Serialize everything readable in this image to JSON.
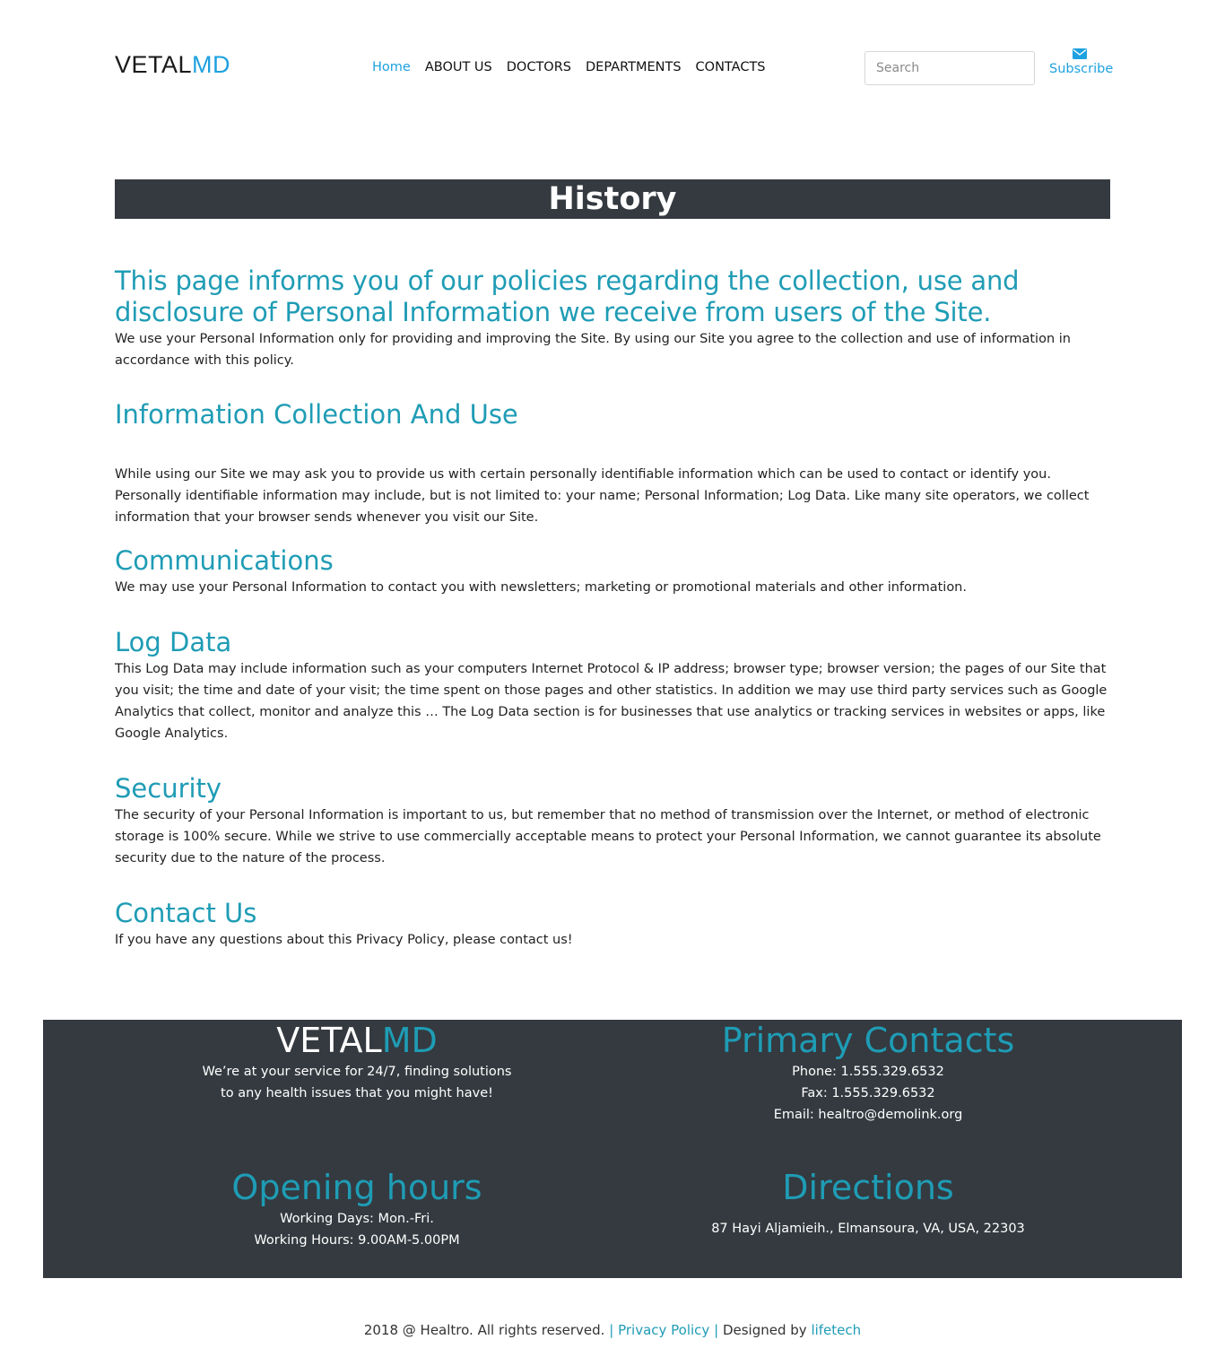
{
  "header": {
    "logo_part1": "VETAL",
    "logo_part2": "MD",
    "nav": [
      "Home",
      "ABOUT US",
      "DOCTORS",
      "DEPARTMENTS",
      "CONTACTS"
    ],
    "search_placeholder": "Search",
    "subscribe_label": "Subscribe",
    "subscribe_icon": "envelope-icon"
  },
  "banner": {
    "title": "History"
  },
  "content": {
    "lead_heading": "This page informs you of our policies regarding the collection, use and disclosure of Personal Information we receive from users of the Site.",
    "lead_text": "We use your Personal Information only for providing and improving the Site. By using our Site you agree to the collection and use of information in accordance with this policy.",
    "sections": [
      {
        "heading": "Information Collection And Use",
        "text": "While using our Site we may ask you to provide us with certain personally identifiable information which can be used to contact or identify you. Personally identifiable information may include, but is not limited to: your name; Personal Information; Log Data. Like many site operators, we collect information that your browser sends whenever you visit our Site."
      },
      {
        "heading": "Communications",
        "text": "We may use your Personal Information to contact you with newsletters; marketing or promotional materials and other information."
      },
      {
        "heading": "Log Data",
        "text": "This Log Data may include information such as your computers Internet Protocol & IP address; browser type; browser version; the pages of our Site that you visit; the time and date of your visit; the time spent on those pages and other statistics. In addition we may use third party services such as Google Analytics that collect, monitor and analyze this … The Log Data section is for businesses that use analytics or tracking services in websites or apps, like Google Analytics."
      },
      {
        "heading": "Security",
        "text": "The security of your Personal Information is important to us, but remember that no method of transmission over the Internet, or method of electronic storage is 100% secure. While we strive to use commercially acceptable means to protect your Personal Information, we cannot guarantee its absolute security due to the nature of the process."
      },
      {
        "heading": "Contact Us",
        "text": "If you have any questions about this Privacy Policy, please contact us!"
      }
    ]
  },
  "footer": {
    "logo_part1": "VETAL",
    "logo_part2": "MD",
    "tagline_1": "We’re at your service for 24/7, finding solutions",
    "tagline_2": "to any health issues that you might have!",
    "contacts_title": "Primary Contacts",
    "phone": "Phone: 1.555.329.6532",
    "fax": "Fax: 1.555.329.6532",
    "email": "Email: healtro@demolink.org",
    "hours_title": "Opening hours",
    "working_days": "Working Days: Mon.-Fri.",
    "working_hours": "Working Hours: 9.00AM-5.00PM",
    "directions_title": "Directions",
    "address": "87 Hayi Aljamieih., Elmansoura, VA, USA, 22303"
  },
  "copyright": {
    "text": "2018 @ Healtro. All rights reserved.",
    "separator": "|",
    "privacy_link": "Privacy Policy",
    "designed_by": "Designed by",
    "designer_link": "lifetech"
  },
  "colors": {
    "accent_blue": "#1ea1e0",
    "heading_teal": "#1f9cb5",
    "dark_band": "#343a40"
  }
}
